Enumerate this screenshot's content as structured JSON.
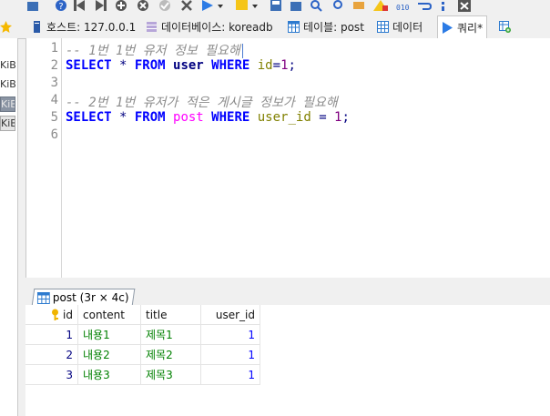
{
  "tabs": [
    {
      "label": "호스트: 127.0.0.1",
      "icon": "host-icon"
    },
    {
      "label": "데이터베이스: koreadb",
      "icon": "database-icon"
    },
    {
      "label": "테이블: post",
      "icon": "table-icon"
    },
    {
      "label": "데이터",
      "icon": "data-grid-icon"
    },
    {
      "label": "쿼리*",
      "icon": "query-play-icon"
    }
  ],
  "left_panel": {
    "sizes": [
      "KiB",
      "KiB",
      "KiB",
      "KiB"
    ]
  },
  "editor": {
    "line_numbers": [
      "1",
      "2",
      "3",
      "4",
      "5",
      "6"
    ],
    "lines": {
      "l1": "-- 1번 1번 유저 정보 필요해",
      "l2_kw1": "SELECT",
      "l2_star": " * ",
      "l2_kw2": "FROM",
      "l2_table": " user ",
      "l2_kw3": "WHERE",
      "l2_field": " id",
      "l2_eq": "=",
      "l2_num": "1",
      "l2_end": ";",
      "l4": "-- 2번 1번 유저가 적은 게시글 정보가 필요해",
      "l5_kw1": "SELECT",
      "l5_star": " * ",
      "l5_kw2": "FROM",
      "l5_table": " post ",
      "l5_kw3": "WHERE",
      "l5_field": " user_id ",
      "l5_eq": "= ",
      "l5_num": "1",
      "l5_end": ";"
    }
  },
  "result_tab": {
    "label": "post (3r × 4c)"
  },
  "grid": {
    "columns": [
      "id",
      "content",
      "title",
      "user_id"
    ],
    "rows": [
      [
        "1",
        "내용1",
        "제목1",
        "1"
      ],
      [
        "2",
        "내용2",
        "제목2",
        "1"
      ],
      [
        "3",
        "내용3",
        "제목3",
        "1"
      ]
    ]
  },
  "colors": {
    "keyword": "#0000ff",
    "table": "#ff00ff",
    "comment": "#8c8c8c",
    "string": "#008000"
  }
}
